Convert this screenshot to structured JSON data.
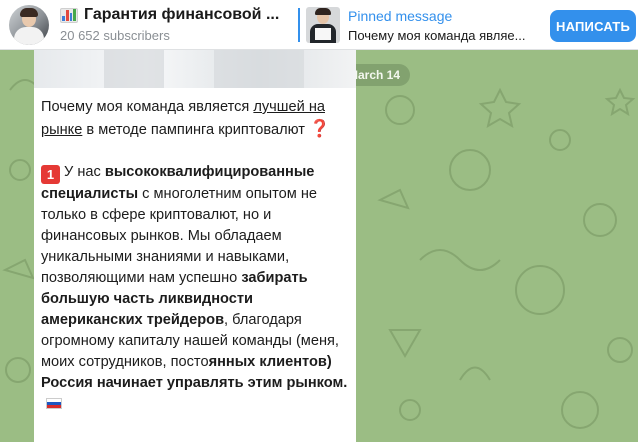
{
  "header": {
    "channel_title": "Гарантия финансовой ...",
    "subscribers": "20 652 subscribers",
    "pinned_label": "Pinned message",
    "pinned_preview": "Почему моя команда являе...",
    "join_label": "НАПИСАТЬ"
  },
  "date_chip": "March 14",
  "message": {
    "p1": {
      "a": "Почему моя команда является ",
      "link": "лучшей на рынке",
      "b": " в методе пампинга криптовалют ",
      "emoji": "❓"
    },
    "p2": {
      "badge": "1",
      "a": "У нас ",
      "b1": "высококвалифицированные специалисты",
      "c": " с многолетним опытом не только в сфере криптовалют, но и финансовых рынков. Мы обладаем уникальными знаниями и навыками, позволяющими нам успешно ",
      "b2": "забирать большую часть ликвидности американских трейдеров",
      "d": ", благодаря огромному капиталу нашей команды (меня, моих сотрудников, посто",
      "b3": "янных клиентов) Россия начинает управлять этим рынком.",
      "flag": "russia-flag"
    }
  },
  "colors": {
    "accent": "#3390ec",
    "background": "#9bbd84",
    "badge": "#e53935"
  }
}
